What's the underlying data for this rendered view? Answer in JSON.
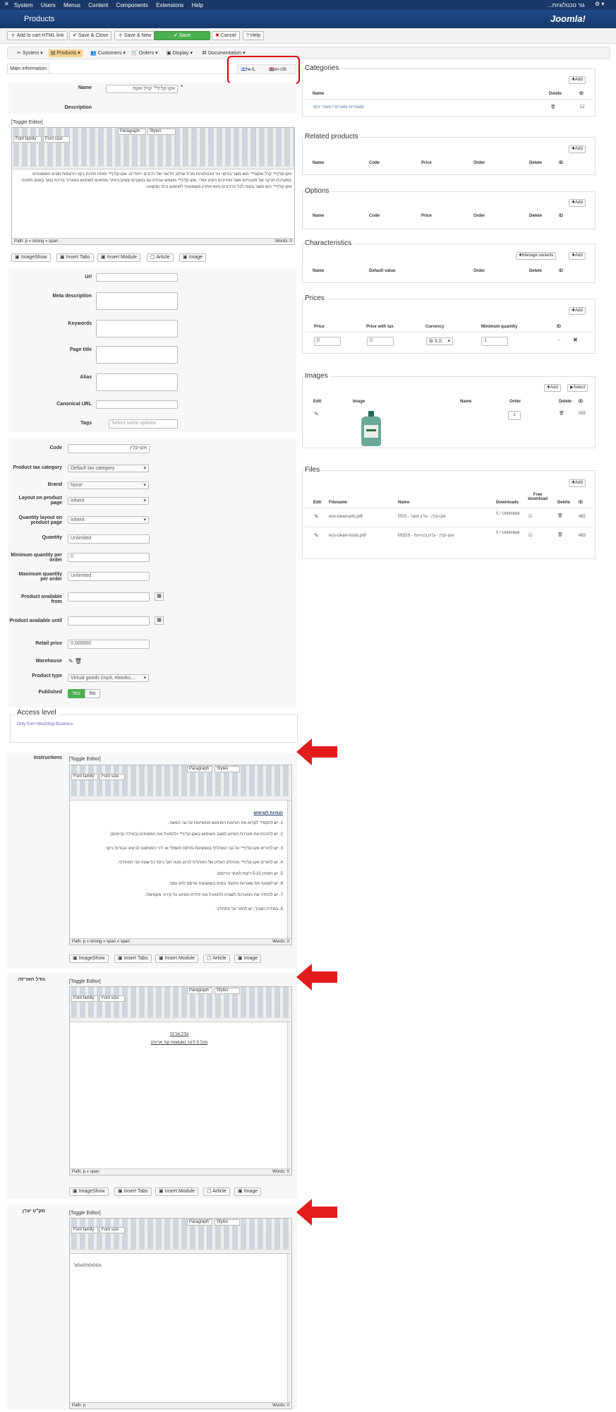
{
  "topbar": {
    "menu": [
      "System",
      "Users",
      "Menus",
      "Content",
      "Components",
      "Extensions",
      "Help"
    ],
    "site_name": "...גור טכנולוגיות"
  },
  "title": {
    "page": "Products",
    "logo_text": "Joomla!"
  },
  "toolbar": {
    "add_to_cart": "Add to cart HTML link",
    "save_close": "Save & Close",
    "save_new": "Save & New",
    "save": "Save",
    "cancel": "Cancel",
    "help": "Help"
  },
  "subnav": [
    "System",
    "Products",
    "Customers",
    "Orders",
    "Display",
    "Documentation"
  ],
  "tabs": {
    "main_info": "Main information",
    "lang_he": "he-IL",
    "lang_en": "en-GB"
  },
  "form": {
    "name_label": "Name",
    "name_value": "אקו-קלין™ קרל אקס",
    "name_required": "*",
    "description_label": "Description",
    "toggle_editor": "[Toggle Editor]",
    "paragraph": "Paragraph",
    "styles": "Styles",
    "font_family": "Font family",
    "font_size": "Font size",
    "editor_path_1": "Path: p » strong » span",
    "editor_words_1": "Words: 0",
    "editor_text_1": "אקו-קלין™ קרל אוקס™ הוא מוצר בניקוי גור טכנולוגיות מכיל שילוב חדשני של רכיבים ייחודיים. אקו-קלין™ פותח תודות ניקוי הרצפות ופנים המשטחים במערכת הניקוי של מטבחים אשר מחייבים ניקיון יסודי. אקו-קלין™ משמש עבודה גם במצבים קשים ביותר ומתאים לשימוש באוורור בריכוז נמוך באופן חסכוני. אקו-קלין™ הוא מוצר בטוח לכל הרכיבים והוא פתרון משמעותי לשימוש ביתי ומקצועי.",
    "btn_imageshow": "ImageShow",
    "btn_insert_tabs": "Insert Tabs",
    "btn_insert_module": "Insert Module",
    "btn_article": "Article",
    "btn_image": "Image",
    "url_label": "Url",
    "meta_label": "Meta description",
    "keywords_label": "Keywords",
    "page_title_label": "Page title",
    "alias_label": "Alias",
    "canonical_label": "Canonical URL",
    "tags_label": "Tags",
    "tags_placeholder": "Select some options",
    "code_label": "Code",
    "code_value": "אקו-קלין",
    "tax_label": "Product tax category",
    "tax_value": "Default tax category",
    "brand_label": "Brand",
    "brand_value": "None",
    "layout_label": "Layout on product page",
    "layout_value": "Inherit",
    "qty_layout_label": "Quantity layout on product page",
    "qty_layout_value": "Inherit",
    "quantity_label": "Quantity",
    "quantity_value": "Unlimited",
    "min_qty_label": "Minimum quantity per order",
    "min_qty_value": "0",
    "max_qty_label": "Maximum quantity per order",
    "max_qty_value": "Unlimited",
    "avail_from_label": "Product available from",
    "avail_until_label": "Product available until",
    "retail_label": "Retail price",
    "retail_value": "0.000000",
    "warehouse_label": "Warehouse",
    "type_label": "Product type",
    "type_value": "Virtual goods (mp3, ebooks,...",
    "published_label": "Published",
    "yes": "Yes",
    "no": "No",
    "access_title": "Access level",
    "access_note": "Only from HikaShop Business"
  },
  "right": {
    "categories": {
      "title": "Categories",
      "add": "Add",
      "headers": [
        "Name",
        "Delete",
        "ID"
      ],
      "rows": [
        {
          "name": "קטגוריות מוצרים / חומרי ניקוי",
          "id": "12"
        }
      ]
    },
    "related": {
      "title": "Related products",
      "add": "Add",
      "headers": [
        "Name",
        "Code",
        "Price",
        "Order",
        "Delete",
        "ID"
      ]
    },
    "options": {
      "title": "Options",
      "add": "Add",
      "headers": [
        "Name",
        "Code",
        "Price",
        "Order",
        "Delete",
        "ID"
      ]
    },
    "characteristics": {
      "title": "Characteristics",
      "manage": "Manage variants",
      "add": "Add",
      "headers": [
        "Name",
        "Default value",
        "Order",
        "Delete",
        "ID"
      ]
    },
    "prices": {
      "title": "Prices",
      "add": "Add",
      "headers": [
        "Price",
        "Price with tax",
        "Currency",
        "Minimum quantity",
        "ID"
      ],
      "row": {
        "price": "0",
        "price_tax": "0",
        "currency": "₪ ILS",
        "min_qty": "1",
        "id": "--"
      }
    },
    "images": {
      "title": "Images",
      "add": "Add",
      "select": "Select",
      "headers": [
        "Edit",
        "Image",
        "Name",
        "Order",
        "Delete",
        "ID"
      ],
      "row": {
        "order": "1",
        "id": "555"
      }
    },
    "files": {
      "title": "Files",
      "add": "Add",
      "headers": [
        "Edit",
        "Filename",
        "Name",
        "Downloads",
        "Free download",
        "Delete",
        "ID"
      ],
      "rows": [
        {
          "filename": "eco-clean-pds.pdf",
          "name": "PDS - אקו-קלין - גליון מוצר",
          "downloads": "0 / Unlimited",
          "id": "482"
        },
        {
          "filename": "eco-clean-msds.pdf",
          "name": "MSDS - אקו-קלין - גליון בטיחות",
          "downloads": "0 / Unlimited",
          "id": "483"
        }
      ]
    }
  },
  "custom": {
    "instructions_label": "Instructions",
    "instructions_title": "הנחיות לשימוש",
    "instructions_lines": [
      "1. יש להקפיד לקרוא את הוראות השימוש המופיעות על גבי המוצר.",
      "2. יש להכניס את מערכת המיזוג למצב השימוש באקו-קלין™ ולהפעיל את המפוחים (במידה וקיימים).",
      "3. יש להזרים אקו-קלין™ על גבי המחליף באמצעות מרסס חשמלי או ידני המותאם לביצוע עבודות ניקוי.",
      "4. יש להזרים אקו-קלין™ מהחלק העליון של המחליף לכיוון מטה תוך כיסוי כל שטח פני המחליף.",
      "5. יש המתין 5-10 דקות לאחר הריסוס.",
      "6. יש לשטוף את שאריות החומר במים באמצעות מרסס לחץ נמוך.",
      "7. יש להחזיר את המערכת לשגרה ולהפעיל את יחידת המיזוג על קירור מקסימלי.",
      "8. במידת הצורך, יש לחזור על התהליך."
    ],
    "instructions_path": "Path: p » strong » span » span",
    "instructions_words": "Words: 0",
    "packaging_label": "גודל האריזה",
    "packaging_line1": "גודל אריזה",
    "packaging_line2": "מכל 5 ליטר (module קוד אריזה)",
    "packaging_path": "Path: p » span",
    "packaging_words": "Words: 0",
    "sku_label": "מק\"ט יצרן",
    "sku_value": "גלגלגלגללגגלגל",
    "sku_path": "Path: p",
    "sku_words": "Words: 0"
  }
}
